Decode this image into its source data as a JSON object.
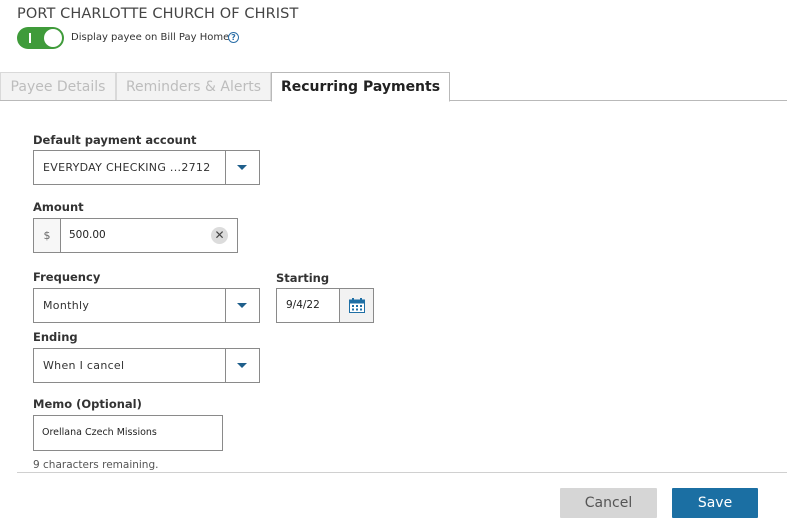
{
  "payee": {
    "name": "PORT CHARLOTTE CHURCH OF CHRIST",
    "toggle_label": "Display payee on Bill Pay Home",
    "toggle_on": true,
    "help_glyph": "?"
  },
  "tabs": [
    {
      "label": "Payee Details",
      "active": false
    },
    {
      "label": "Reminders & Alerts",
      "active": false
    },
    {
      "label": "Recurring Payments",
      "active": true
    }
  ],
  "form": {
    "account": {
      "label": "Default payment account",
      "value": "EVERYDAY CHECKING ...2712"
    },
    "amount": {
      "label": "Amount",
      "prefix": "$",
      "value": "500.00",
      "clear_glyph": "✕"
    },
    "frequency": {
      "label": "Frequency",
      "value": "Monthly"
    },
    "starting": {
      "label": "Starting",
      "value": "9/4/22"
    },
    "ending": {
      "label": "Ending",
      "value": "When I cancel"
    },
    "memo": {
      "label": "Memo (Optional)",
      "value": "Orellana Czech Missions",
      "remaining": "9 characters remaining."
    }
  },
  "buttons": {
    "cancel": "Cancel",
    "save": "Save"
  },
  "colors": {
    "toggle_green": "#3f9b3a",
    "primary_blue": "#1b6fa3",
    "chevron_blue": "#1f5f8b"
  },
  "icons": {
    "dropdown": "chevron-down-icon",
    "calendar": "calendar-icon",
    "clear": "clear-icon",
    "help": "help-icon"
  }
}
